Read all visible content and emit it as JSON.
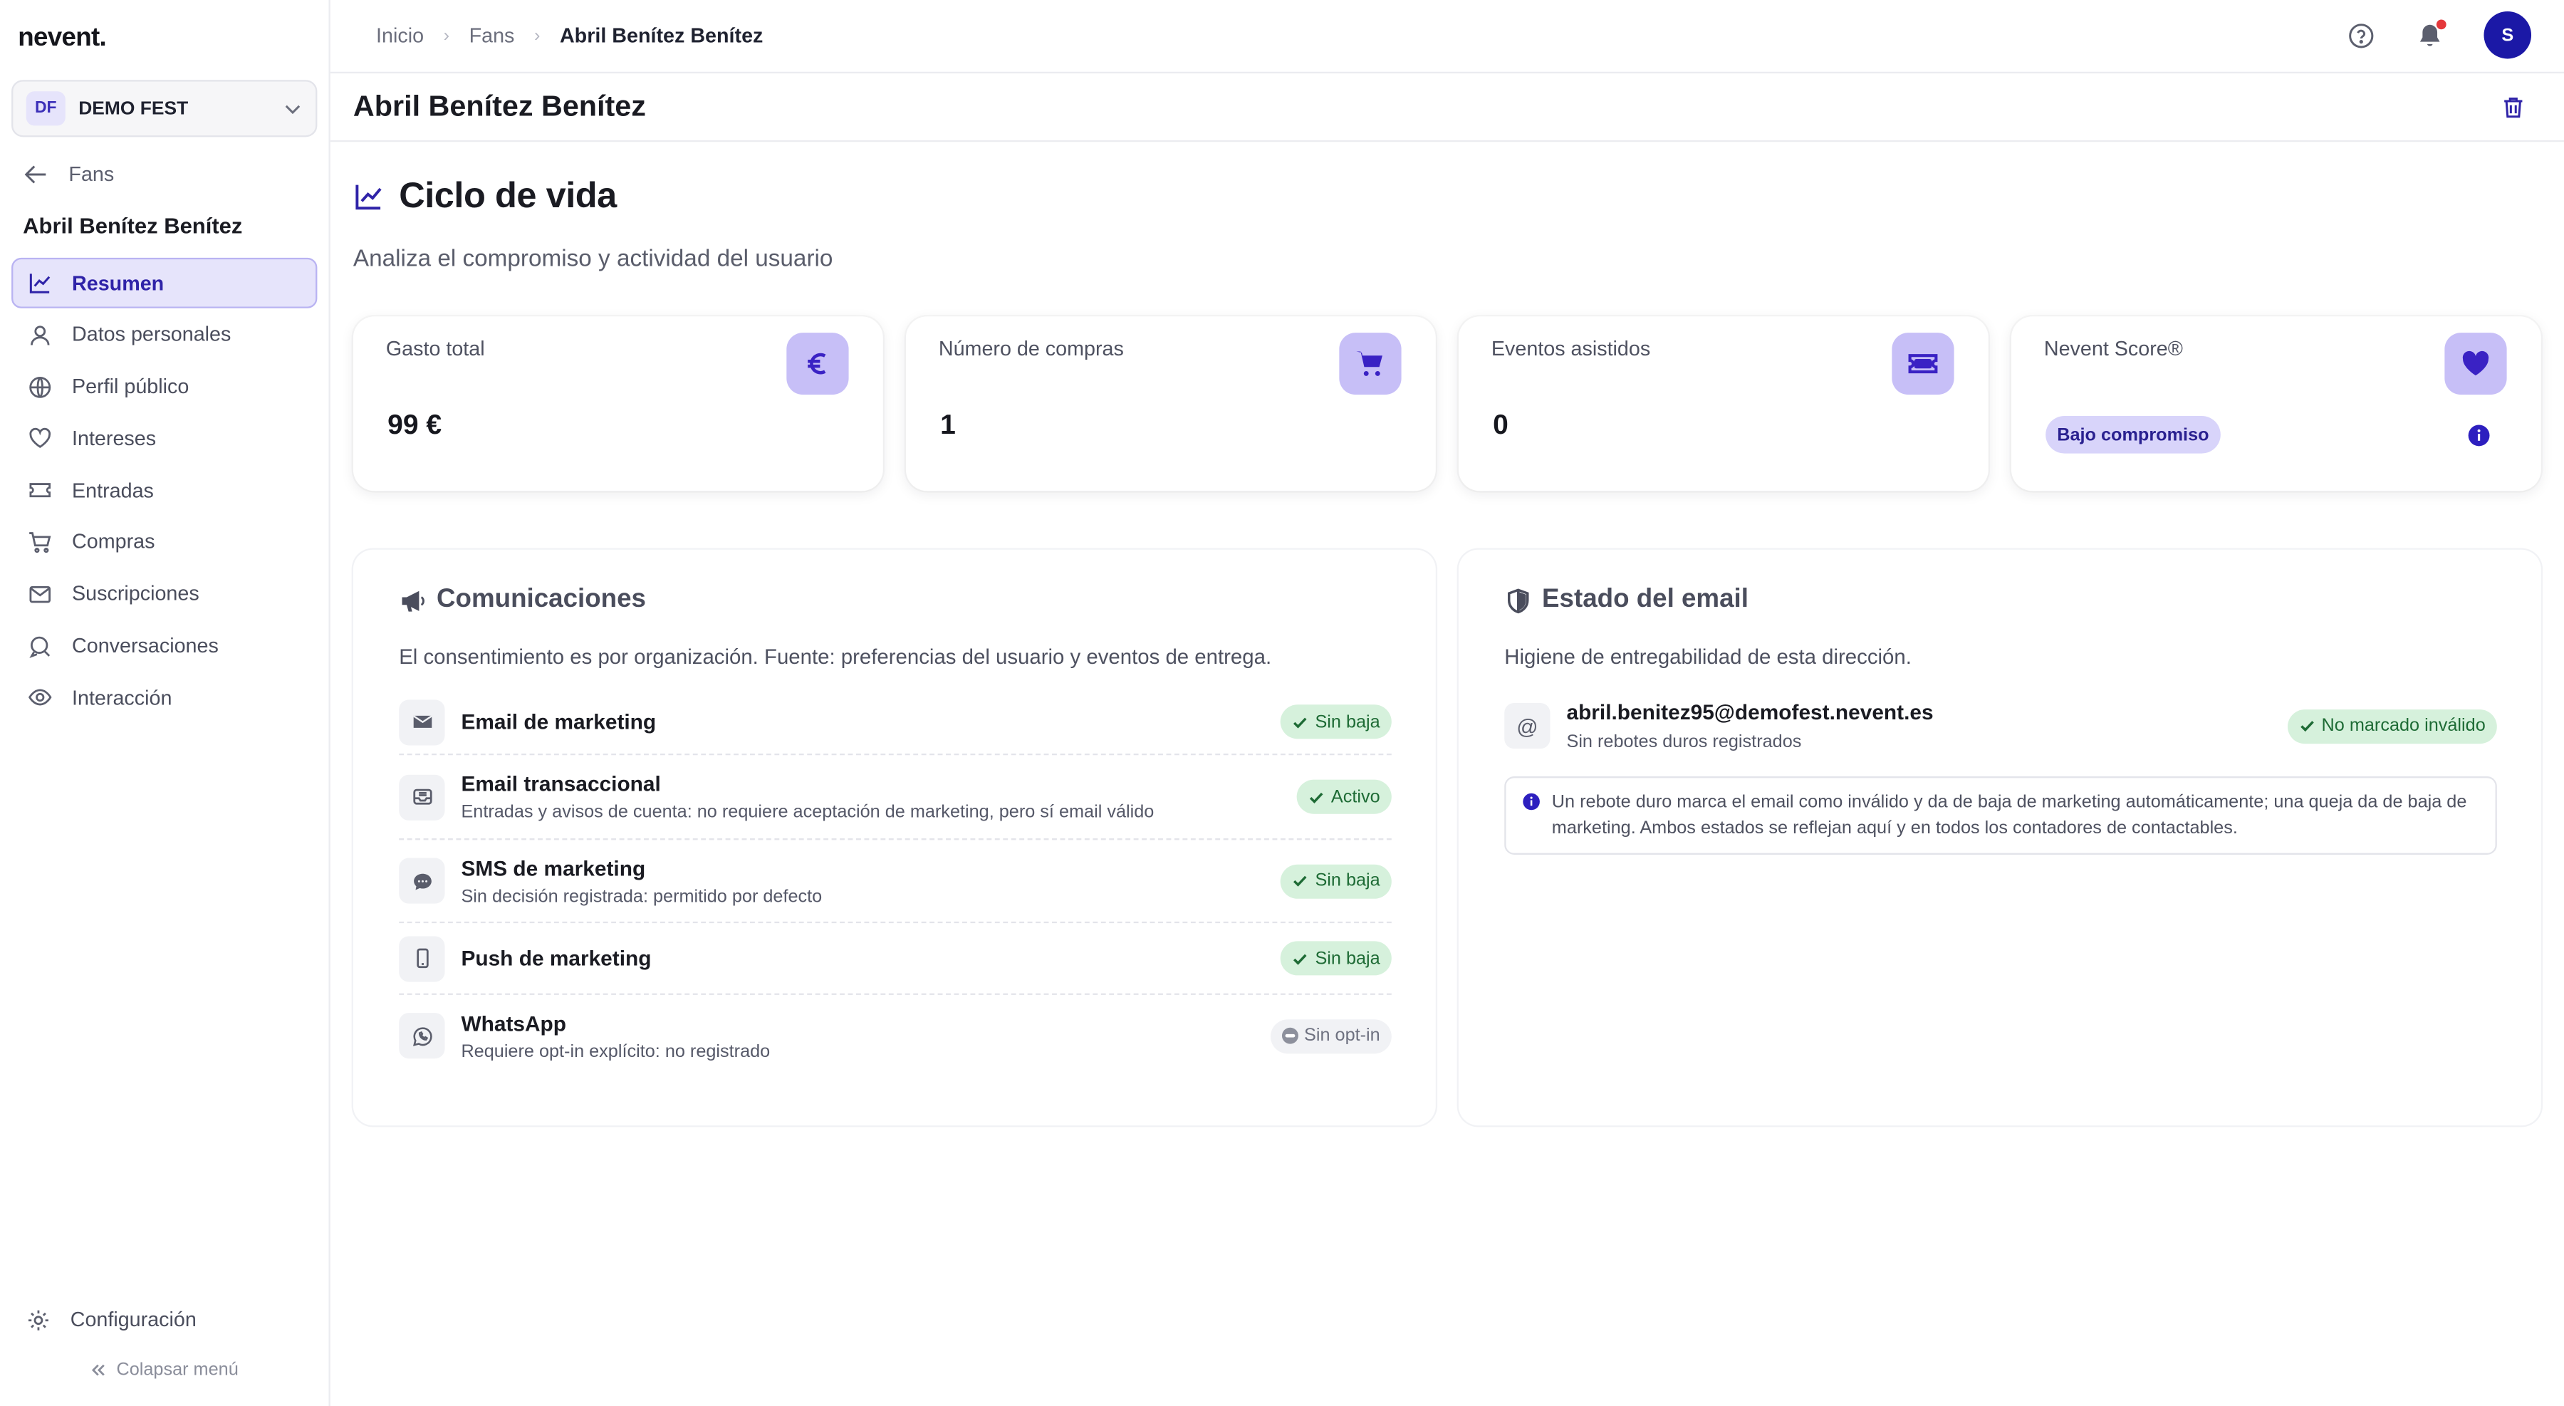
{
  "app": {
    "logo": "nevent."
  },
  "org": {
    "badge": "DF",
    "name": "DEMO FEST"
  },
  "sidebar": {
    "back_label": "Fans",
    "user_name": "Abril Benítez Benítez",
    "items": [
      {
        "label": "Resumen",
        "icon": "chart-line-icon",
        "active": true
      },
      {
        "label": "Datos personales",
        "icon": "user-icon"
      },
      {
        "label": "Perfil público",
        "icon": "globe-icon"
      },
      {
        "label": "Intereses",
        "icon": "heart-icon"
      },
      {
        "label": "Entradas",
        "icon": "ticket-icon"
      },
      {
        "label": "Compras",
        "icon": "cart-icon"
      },
      {
        "label": "Suscripciones",
        "icon": "mail-icon"
      },
      {
        "label": "Conversaciones",
        "icon": "chat-icon"
      },
      {
        "label": "Interacción",
        "icon": "eye-icon"
      }
    ],
    "config_label": "Configuración",
    "collapse_label": "Colapsar menú"
  },
  "breadcrumb": {
    "items": [
      "Inicio",
      "Fans"
    ],
    "current": "Abril Benítez Benítez"
  },
  "header": {
    "avatar_initial": "S",
    "title": "Abril Benítez Benítez"
  },
  "lifecycle": {
    "title": "Ciclo de vida",
    "subtitle": "Analiza el compromiso y actividad del usuario"
  },
  "stats": {
    "spend": {
      "label": "Gasto total",
      "value": "99 €",
      "icon": "euro-icon"
    },
    "purchases": {
      "label": "Número de compras",
      "value": "1",
      "icon": "cart-icon"
    },
    "events": {
      "label": "Eventos asistidos",
      "value": "0",
      "icon": "ticket-icon"
    },
    "score": {
      "label": "Nevent Score®",
      "badge": "Bajo compromiso",
      "icon": "heart-icon"
    }
  },
  "communications": {
    "title": "Comunicaciones",
    "subtitle": "El consentimiento es por organización. Fuente: preferencias del usuario y eventos de entrega.",
    "rows": [
      {
        "name": "Email de marketing",
        "desc": "",
        "status": "Sin baja",
        "icon": "envelope-icon"
      },
      {
        "name": "Email transaccional",
        "desc": "Entradas y avisos de cuenta: no requiere aceptación de marketing, pero sí email válido",
        "status": "Activo",
        "icon": "inbox-icon"
      },
      {
        "name": "SMS de marketing",
        "desc": "Sin decisión registrada: permitido por defecto",
        "status": "Sin baja",
        "icon": "sms-icon"
      },
      {
        "name": "Push de marketing",
        "desc": "",
        "status": "Sin baja",
        "icon": "phone-icon"
      },
      {
        "name": "WhatsApp",
        "desc": "Requiere opt-in explícito: no registrado",
        "status": "Sin opt-in",
        "icon": "whatsapp-icon"
      }
    ]
  },
  "email_status": {
    "title": "Estado del email",
    "subtitle": "Higiene de entregabilidad de esta dirección.",
    "address": "abril.benitez95@demofest.nevent.es",
    "detail": "Sin rebotes duros registrados",
    "status": "No marcado inválido",
    "note": "Un rebote duro marca el email como inválido y da de baja de marketing automáticamente; una queja da de baja de marketing. Ambos estados se reflejan aquí y en todos los contadores de contactables."
  },
  "colors": {
    "accent": "#2f23a8",
    "accent_soft": "#e6e4fb",
    "icon_tile": "#c7bff7",
    "success_bg": "#d6f1dc",
    "success_text": "#1e6b35"
  }
}
